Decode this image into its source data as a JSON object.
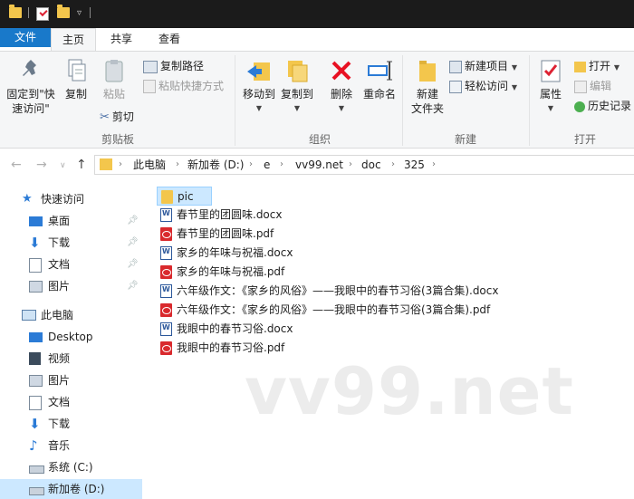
{
  "ribbon_tabs": [
    "文件",
    "主页",
    "共享",
    "查看"
  ],
  "clipboard": {
    "pin_label_1": "固定到\"快",
    "pin_label_2": "速访问\"",
    "copy_label": "复制",
    "paste_label": "粘贴",
    "copy_path_label": "复制路径",
    "paste_shortcut_label": "粘贴快捷方式",
    "cut_label": "剪切",
    "group_label": "剪贴板"
  },
  "organize": {
    "move_to_label": "移动到",
    "copy_to_label": "复制到",
    "delete_label": "删除",
    "rename_label": "重命名",
    "group_label": "组织"
  },
  "new": {
    "new_folder_label_1": "新建",
    "new_folder_label_2": "文件夹",
    "new_item_label": "新建项目",
    "easy_access_label": "轻松访问",
    "group_label": "新建"
  },
  "open": {
    "properties_label": "属性",
    "open_label": "打开",
    "edit_label": "编辑",
    "history_label": "历史记录",
    "group_label": "打开"
  },
  "address": {
    "crumbs": [
      "此电脑",
      "新加卷 (D:)",
      "e",
      "vv99.net",
      "doc",
      "325"
    ]
  },
  "nav_pane": {
    "quick_access": "快速访问",
    "quick_items": [
      "桌面",
      "下载",
      "文档",
      "图片"
    ],
    "this_pc": "此电脑",
    "pc_items": [
      "Desktop",
      "视频",
      "图片",
      "文档",
      "下载",
      "音乐",
      "系统 (C:)",
      "新加卷 (D:)"
    ]
  },
  "files": [
    {
      "name": "pic",
      "type": "folder"
    },
    {
      "name": "春节里的团圆味.docx",
      "type": "docx"
    },
    {
      "name": "春节里的团圆味.pdf",
      "type": "pdf"
    },
    {
      "name": "家乡的年味与祝福.docx",
      "type": "docx"
    },
    {
      "name": "家乡的年味与祝福.pdf",
      "type": "pdf"
    },
    {
      "name": "六年级作文：《家乡的风俗》——我眼中的春节习俗(3篇合集).docx",
      "type": "docx"
    },
    {
      "name": "六年级作文：《家乡的风俗》——我眼中的春节习俗(3篇合集).pdf",
      "type": "pdf"
    },
    {
      "name": "我眼中的春节习俗.docx",
      "type": "docx"
    },
    {
      "name": "我眼中的春节习俗.pdf",
      "type": "pdf"
    }
  ],
  "watermark": "vv99.net",
  "colors": {
    "file_tab": "#1979ca",
    "selection": "#cce8ff",
    "folder": "#f3c64c",
    "pdf": "#d9292d",
    "word": "#2b579a",
    "delete_red": "#e81123"
  }
}
